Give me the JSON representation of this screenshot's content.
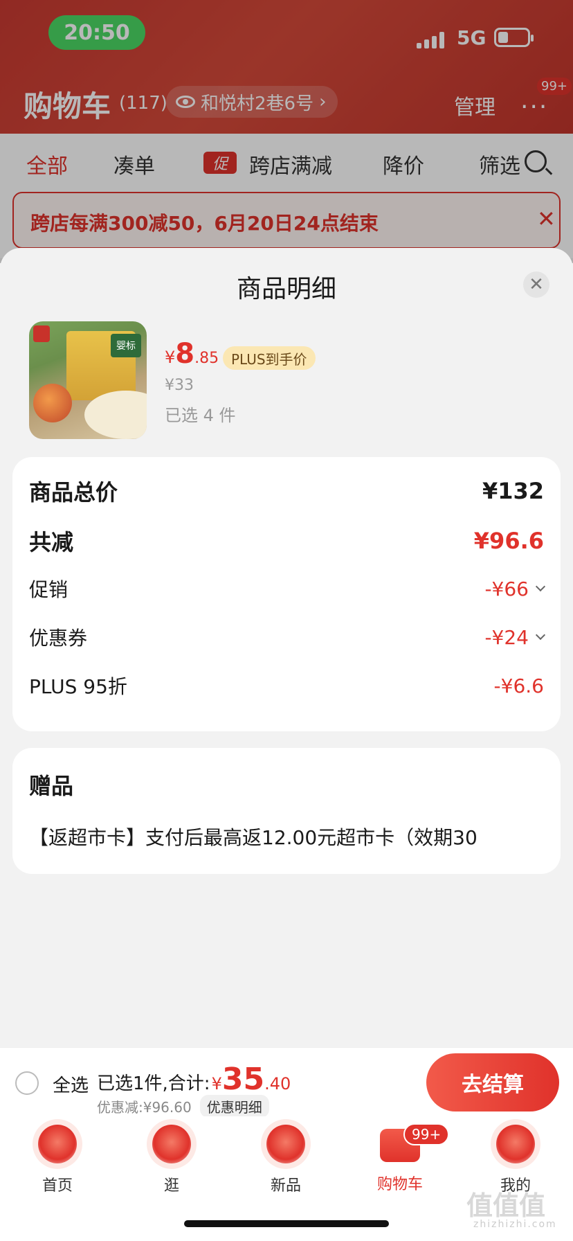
{
  "status": {
    "time": "20:50",
    "network": "5G"
  },
  "header": {
    "title": "购物车",
    "count": "(117)",
    "address": "和悦村2巷6号",
    "address_arrow": "›",
    "manage": "管理",
    "more": "···",
    "more_badge": "99+"
  },
  "filters": {
    "all": "全部",
    "combine": "凑单",
    "promo_tag": "促",
    "cross_store": "跨店满减",
    "price_drop": "降价",
    "filter": "筛选"
  },
  "promo_banner": {
    "text": "跨店每满300减50，6月20日24点结束",
    "close": "✕"
  },
  "sheet": {
    "title": "商品明细",
    "close": "✕",
    "product": {
      "price_symbol": "¥",
      "price_int": "8",
      "price_dec": ".85",
      "plus_tag": "PLUS到手价",
      "original_price": "¥33",
      "selected": "已选 4 件",
      "box_label": "婴标"
    },
    "breakdown": {
      "total_label": "商品总价",
      "total_value": "¥132",
      "discount_label": "共减",
      "discount_value": "¥96.6",
      "promo_label": "促销",
      "promo_value": "-¥66",
      "coupon_label": "优惠券",
      "coupon_value": "-¥24",
      "plus_label": "PLUS 95折",
      "plus_value": "-¥6.6"
    },
    "gift": {
      "title": "赠品",
      "text": "【返超市卡】支付后最高返12.00元超市卡（效期30"
    }
  },
  "checkout": {
    "select_all": "全选",
    "summary_prefix": "已选1件,合计:",
    "total_symbol": "¥",
    "total_int": "35",
    "total_dec": ".40",
    "discount_text": "优惠减:¥96.60",
    "detail_chip": "优惠明细",
    "button": "去结算"
  },
  "tabbar": {
    "home": "首页",
    "browse": "逛",
    "new": "新品",
    "cart": "购物车",
    "cart_badge": "99+",
    "mine": "我的"
  },
  "watermark": {
    "main": "值值值",
    "sub": "zhizhizhi.com"
  },
  "colors": {
    "accent": "#e0322b",
    "header_bg": "#c93a31",
    "plus_tag_bg": "#fbe7b3"
  },
  "icons": [
    "eye-icon",
    "search-icon",
    "close-icon",
    "chevron-down-icon",
    "home-icon",
    "browse-icon",
    "new-icon",
    "cart-icon",
    "profile-icon"
  ]
}
